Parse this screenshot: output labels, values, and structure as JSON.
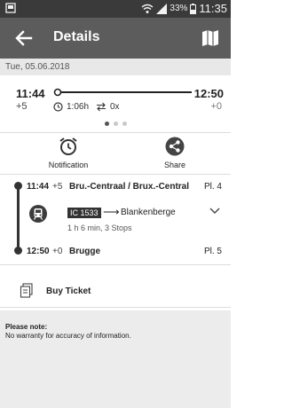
{
  "status_bar": {
    "battery": "33%",
    "time": "11:35",
    "icons": [
      "screenshot-icon",
      "wifi-icon",
      "signal-icon",
      "battery-icon"
    ]
  },
  "app_bar": {
    "title": "Details",
    "icons": [
      "back-arrow-icon",
      "map-icon"
    ]
  },
  "date": "Tue, 05.06.2018",
  "overview": {
    "departure_time": "11:44",
    "departure_delay": "+5",
    "arrival_time": "12:50",
    "arrival_delay": "+0",
    "duration": "1:06h",
    "changes": "0x",
    "pages": 3,
    "current_page": 1
  },
  "actions": [
    {
      "label": "Notification",
      "icon": "alarm-clock-icon"
    },
    {
      "label": "Share",
      "icon": "share-icon"
    }
  ],
  "journey": {
    "departure": {
      "time": "11:44",
      "delay": "+5",
      "station": "Bru.-Centraal / Brux.-Central",
      "platform": "Pl. 4"
    },
    "train": {
      "number": "IC 1533",
      "arrow": "⟶",
      "destination": "Blankenberge",
      "info": "1 h 6 min, 3 Stops"
    },
    "arrival": {
      "time": "12:50",
      "delay": "+0",
      "station": "Brugge",
      "platform": "Pl. 5"
    }
  },
  "buy_ticket": {
    "label": "Buy Ticket",
    "icon": "ticket-icon"
  },
  "note": {
    "title": "Please note:",
    "text": "No warranty for accuracy of information."
  },
  "colors": {
    "app_bar": "#5c5c5c",
    "status_bar": "#3a3a3a",
    "date_band": "#e8e8e8",
    "note_band": "#ececec"
  }
}
